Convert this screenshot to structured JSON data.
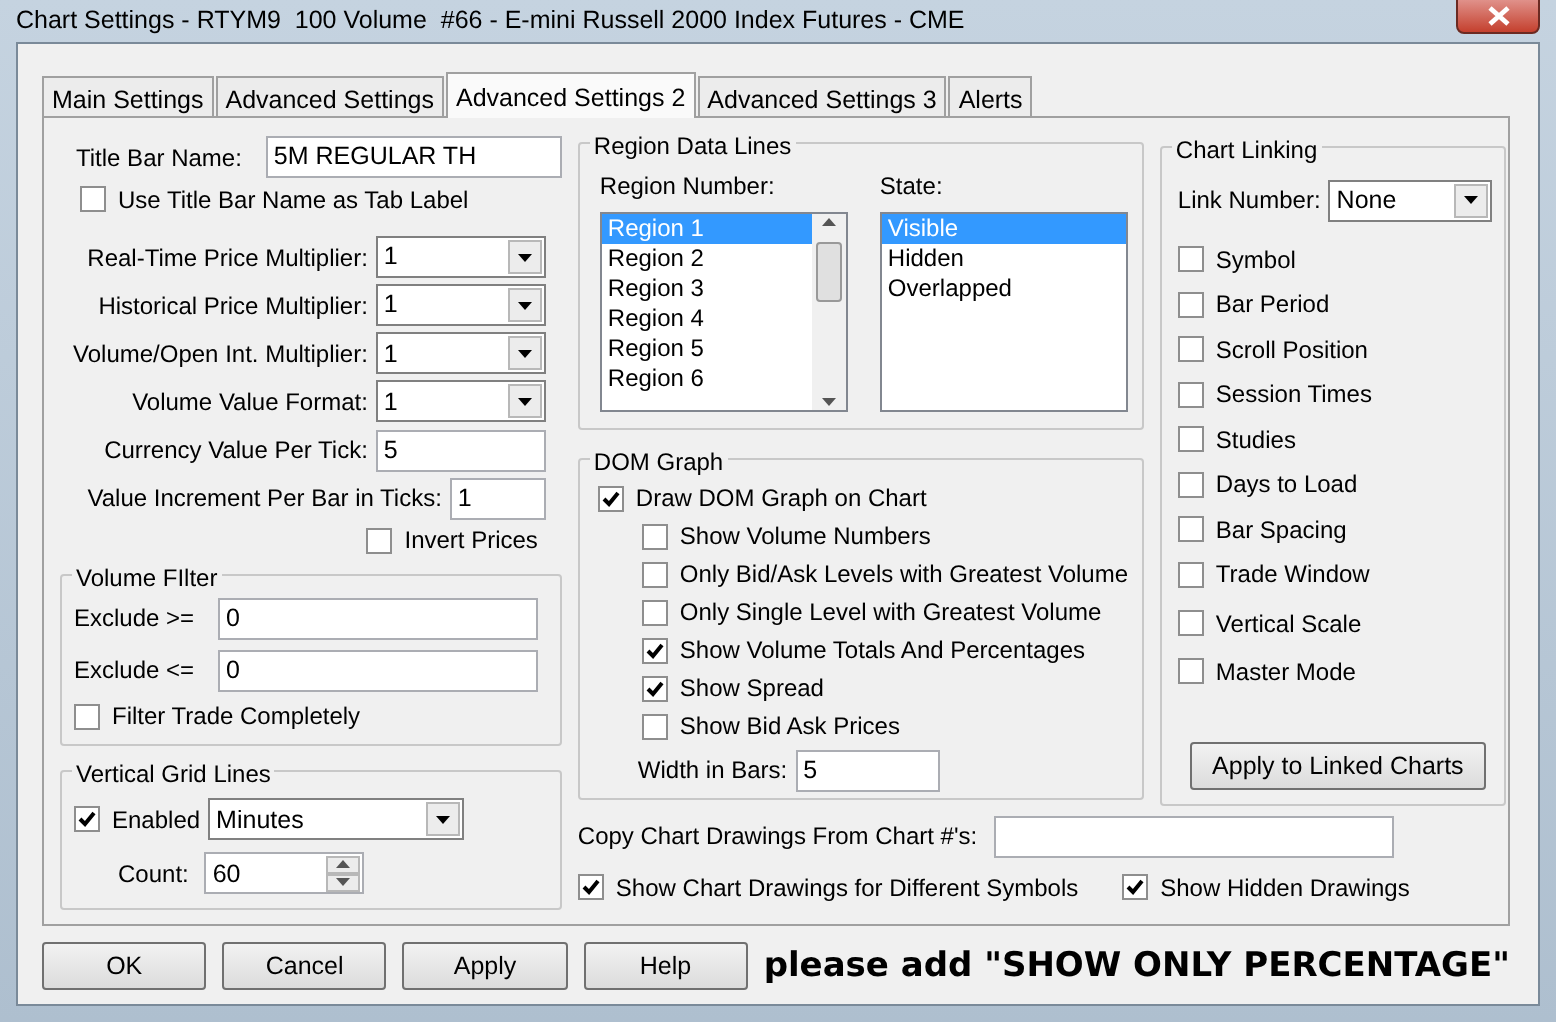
{
  "window": {
    "title": "Chart Settings - RTYM9  100 Volume  #66 - E-mini Russell 2000 Index Futures - CME"
  },
  "tabs": [
    {
      "label": "Main Settings",
      "selected": false
    },
    {
      "label": "Advanced Settings",
      "selected": false
    },
    {
      "label": "Advanced Settings 2",
      "selected": true
    },
    {
      "label": "Advanced Settings 3",
      "selected": false
    },
    {
      "label": "Alerts",
      "selected": false
    }
  ],
  "general": {
    "title_bar_name": {
      "label": "Title Bar Name:",
      "value": "5M REGULAR TH"
    },
    "use_title_as_tab": {
      "label": "Use Title Bar Name as Tab Label",
      "checked": false
    },
    "fields": [
      {
        "kind": "dropdown",
        "label": "Real-Time Price Multiplier:",
        "value": "1"
      },
      {
        "kind": "dropdown",
        "label": "Historical Price Multiplier:",
        "value": "1"
      },
      {
        "kind": "dropdown",
        "label": "Volume/Open Int. Multiplier:",
        "value": "1"
      },
      {
        "kind": "dropdown",
        "label": "Volume Value Format:",
        "value": "1"
      },
      {
        "kind": "text",
        "label": "Currency Value Per Tick:",
        "value": "5"
      },
      {
        "kind": "text",
        "label": "Value Increment Per Bar in Ticks:",
        "value": "1"
      }
    ],
    "invert_prices": {
      "label": "Invert Prices",
      "checked": false
    }
  },
  "volume_filter": {
    "title": "Volume FIlter",
    "fields": [
      {
        "label": "Exclude >=",
        "value": "0"
      },
      {
        "label": "Exclude <=",
        "value": "0"
      }
    ],
    "filter_trade_completely": {
      "label": "Filter Trade Completely",
      "checked": false
    }
  },
  "vertical_grid_lines": {
    "title": "Vertical Grid Lines",
    "enabled": {
      "label": "Enabled",
      "checked": true
    },
    "unit": "Minutes",
    "count": {
      "label": "Count:",
      "value": "60"
    }
  },
  "region_data_lines": {
    "title": "Region Data Lines",
    "region_label": "Region Number:",
    "regions": [
      {
        "label": "Region 1",
        "selected": true
      },
      {
        "label": "Region 2",
        "selected": false
      },
      {
        "label": "Region 3",
        "selected": false
      },
      {
        "label": "Region 4",
        "selected": false
      },
      {
        "label": "Region 5",
        "selected": false
      },
      {
        "label": "Region 6",
        "selected": false
      }
    ],
    "state_label": "State:",
    "states": [
      {
        "label": "Visible",
        "selected": true
      },
      {
        "label": "Hidden",
        "selected": false
      },
      {
        "label": "Overlapped",
        "selected": false
      }
    ]
  },
  "dom_graph": {
    "title": "DOM Graph",
    "draw": {
      "label": "Draw DOM Graph on Chart",
      "checked": true
    },
    "options": [
      {
        "label": "Show Volume Numbers",
        "checked": false
      },
      {
        "label": "Only Bid/Ask Levels with Greatest Volume",
        "checked": false
      },
      {
        "label": "Only Single Level with Greatest Volume",
        "checked": false
      },
      {
        "label": "Show Volume Totals And Percentages",
        "checked": true
      },
      {
        "label": "Show Spread",
        "checked": true
      },
      {
        "label": "Show Bid  Ask Prices",
        "checked": false
      }
    ],
    "width": {
      "label": "Width in Bars:",
      "value": "5"
    }
  },
  "copy_drawings": {
    "label": "Copy Chart Drawings From Chart #'s:"
  },
  "show_drawings_different_symbols": {
    "label": "Show Chart Drawings for Different Symbols",
    "checked": true
  },
  "show_hidden_drawings": {
    "label": "Show Hidden Drawings",
    "checked": true
  },
  "chart_linking": {
    "title": "Chart Linking",
    "link_number": {
      "label": "Link Number:",
      "value": "None"
    },
    "options": [
      {
        "label": "Symbol",
        "checked": false
      },
      {
        "label": "Bar Period",
        "checked": false
      },
      {
        "label": "Scroll Position",
        "checked": false
      },
      {
        "label": "Session Times",
        "checked": false
      },
      {
        "label": "Studies",
        "checked": false
      },
      {
        "label": "Days to Load",
        "checked": false
      },
      {
        "label": "Bar Spacing",
        "checked": false
      },
      {
        "label": "Trade Window",
        "checked": false
      },
      {
        "label": "Vertical Scale",
        "checked": false
      },
      {
        "label": "Master Mode",
        "checked": false
      }
    ],
    "apply_button": "Apply to Linked Charts"
  },
  "buttons": [
    "OK",
    "Cancel",
    "Apply",
    "Help"
  ],
  "annotation": "please add \"SHOW ONLY PERCENTAGE\""
}
